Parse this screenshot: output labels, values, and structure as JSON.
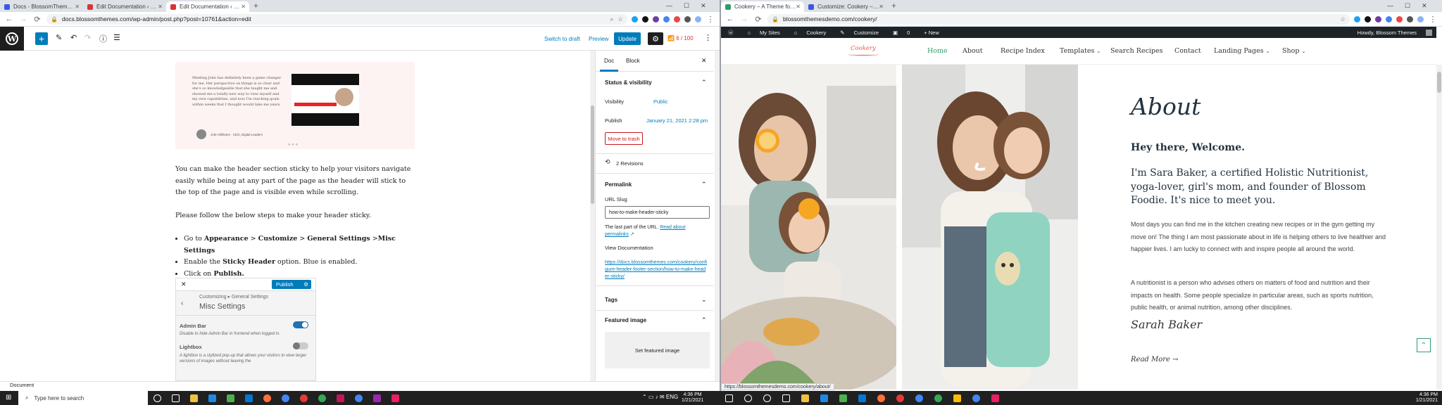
{
  "left_browser": {
    "tabs": [
      {
        "title": "Docs - BlossomThemes — WordPress",
        "favicon": "#3858e9"
      },
      {
        "title": "Edit Documentation ‹ BlossomThemes",
        "favicon": "#d63638"
      },
      {
        "title": "Edit Documentation ‹ BlossomThemes",
        "favicon": "#d63638"
      }
    ],
    "url": "docs.blossomthemes.com/wp-admin/post.php?post=10761&action=edit"
  },
  "right_browser": {
    "tabs": [
      {
        "title": "Cookery – A Theme for Food Bl",
        "favicon": "#2f9c6f"
      },
      {
        "title": "Customize: Cookery – A Theme",
        "favicon": "#3858e9"
      }
    ],
    "url": "blossomthemesdemo.com/cookery/"
  },
  "editor": {
    "switch_draft": "Switch to draft",
    "preview": "Preview",
    "update": "Update",
    "score": "6 / 100",
    "testimonial_quote": "Meeting John has definitely been a game changer for me. Her perspective on things is so clear and she's so knowledgeable that she taught me and showed me a totally new way to view myself and my own capabilities, and now I'm reaching goals within weeks that I thought would take me years.",
    "testimonial_author": "John Williams · CEO, Digital Leaders",
    "para1": "You can make the header section sticky to help your visitors navigate easily while being at any part of the page as the header will stick to the top of the page and is visible even while scrolling.",
    "para2": "Please follow the below steps to make your header sticky.",
    "step1_prefix": "Go to ",
    "step1_a": "Appearance",
    "step1_sep1": " > ",
    "step1_b": "Customize",
    "step1_sep2": " > ",
    "step1_c": "General Settings",
    "step1_sep3": " >",
    "step1_d": "Misc Settings",
    "step2_prefix": "Enable the ",
    "step2_b": "Sticky Header",
    "step2_suffix": " option. Blue is enabled.",
    "step3_prefix": "Click on ",
    "step3_b": "Publish.",
    "cust_publish": "Publish",
    "cust_breadcrumb": "Customizing ▸ General Settings",
    "cust_title": "Misc Settings",
    "cust_admin_bar": "Admin Bar",
    "cust_admin_bar_desc": "Disable to hide Admin Bar in frontend when logged in.",
    "cust_lightbox": "Lightbox",
    "cust_lightbox_desc": "A lightbox is a stylized pop-up that allows your visitors to view larger versions of images without leaving the",
    "footer": "Document"
  },
  "sidebar": {
    "tab_doc": "Doc",
    "tab_block": "Block",
    "status_title": "Status & visibility",
    "visibility_label": "Visibility",
    "visibility_value": "Public",
    "publish_label": "Publish",
    "publish_value": "January 21, 2021 2:28 pm",
    "trash": "Move to trash",
    "revisions": "2 Revisions",
    "permalink_title": "Permalink",
    "url_slug_label": "URL Slug",
    "url_slug": "how-to-make-header-sticky",
    "slug_help": "The last part of the URL.",
    "read_about": "Read about",
    "permalinks": "permalinks",
    "view_doc": "View Documentation",
    "doc_link": "https://docs.blossomthemes.com/cookery/configure-header-footer-section/how-to-make-header-sticky/",
    "tags_title": "Tags",
    "featured_title": "Featured image",
    "set_featured": "Set featured image"
  },
  "site": {
    "admin_bar": [
      "My Sites",
      "Cookery",
      "Customize",
      "0",
      "+ New"
    ],
    "howdy": "Howdy, Blossom Themes",
    "logo": "Cookery",
    "nav": [
      "Home",
      "About",
      "Recipe Index",
      "Templates",
      "Search Recipes",
      "Contact",
      "Landing Pages",
      "Shop"
    ],
    "about_title": "About",
    "hey": "Hey there, Welcome.",
    "intro": "I'm Sara Baker, a certified Holistic Nutritionist, yoga-lover, girl's mom, and founder of Blossom Foodie. It's nice to meet you.",
    "para1": "Most days you can find me in the kitchen creating new recipes or in the gym getting my move on! The thing I am most passionate about in life is helping others to live healthier and happier lives. I am lucky to connect with and inspire people all around the world.",
    "para2": "A nutritionist is a person who advises others on matters of food and nutrition and their impacts on health. Some people specialize in particular areas, such as sports nutrition, public health, or animal nutrition, among other disciplines.",
    "signature": "Sarah Baker",
    "read_more": "Read More",
    "status_url": "https://blossomthemesdemo.com/cookery/about/"
  },
  "taskbar": {
    "search_placeholder": "Type here to search",
    "time": "4:36 PM",
    "date": "1/21/2021"
  },
  "colors": {
    "wp_blue": "#007cba",
    "accent_green": "#2f9c6f",
    "danger": "#cc1818"
  }
}
